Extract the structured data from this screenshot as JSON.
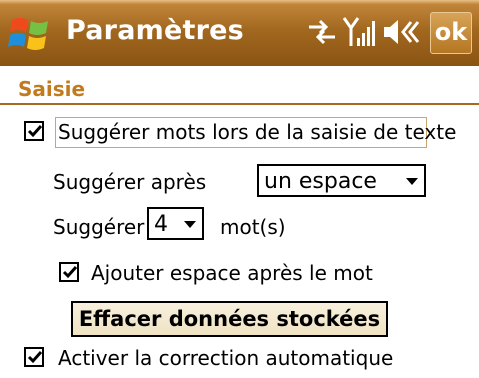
{
  "titlebar": {
    "title": "Paramètres",
    "ok_label": "ok",
    "icons": [
      "windows-start-icon",
      "connectivity-icon",
      "signal-icon",
      "volume-mute-icon"
    ]
  },
  "section": {
    "title": "Saisie"
  },
  "options": {
    "suggest_words": {
      "label": "Suggérer mots lors de la saisie de texte",
      "checked": true
    },
    "suggest_after": {
      "label": "Suggérer après",
      "value": "un espace"
    },
    "suggest_count": {
      "label": "Suggérer",
      "value": "4",
      "unit": "mot(s)"
    },
    "add_space": {
      "label": "Ajouter espace après le mot",
      "checked": true
    },
    "clear_button": "Effacer données stockées",
    "auto_correct": {
      "label": "Activer la correction automatique",
      "checked": true
    }
  },
  "colors": {
    "titlebar": "#a2681f",
    "section_title": "#c27a1c",
    "button_face": "#f3e9cf"
  }
}
